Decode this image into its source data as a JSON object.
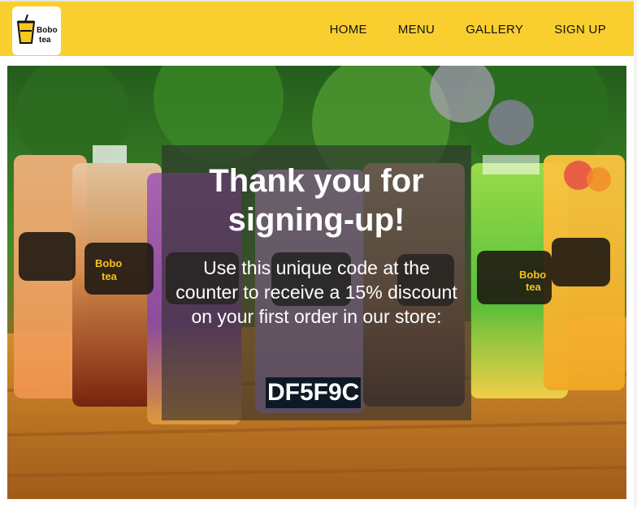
{
  "brand": {
    "logo_text_top": "Bobo",
    "logo_text_bottom": "tea",
    "logo_icon": "boba-cup-icon"
  },
  "nav": {
    "items": [
      {
        "label": "HOME"
      },
      {
        "label": "MENU"
      },
      {
        "label": "GALLERY"
      },
      {
        "label": "SIGN UP"
      }
    ]
  },
  "hero": {
    "cup_label_top": "Bobo",
    "cup_label_bottom": "tea"
  },
  "signup": {
    "heading_line1": "Thank you for",
    "heading_line2": "signing-up!",
    "message": "Use this unique code at the counter to receive a 15% discount on your first order in our store:",
    "code": "DF5F9C"
  },
  "colors": {
    "navbar": "#f9cf2f",
    "overlay": "rgba(45,45,45,0.62)",
    "code_background": "#0d1a26",
    "text": "#ffffff"
  }
}
